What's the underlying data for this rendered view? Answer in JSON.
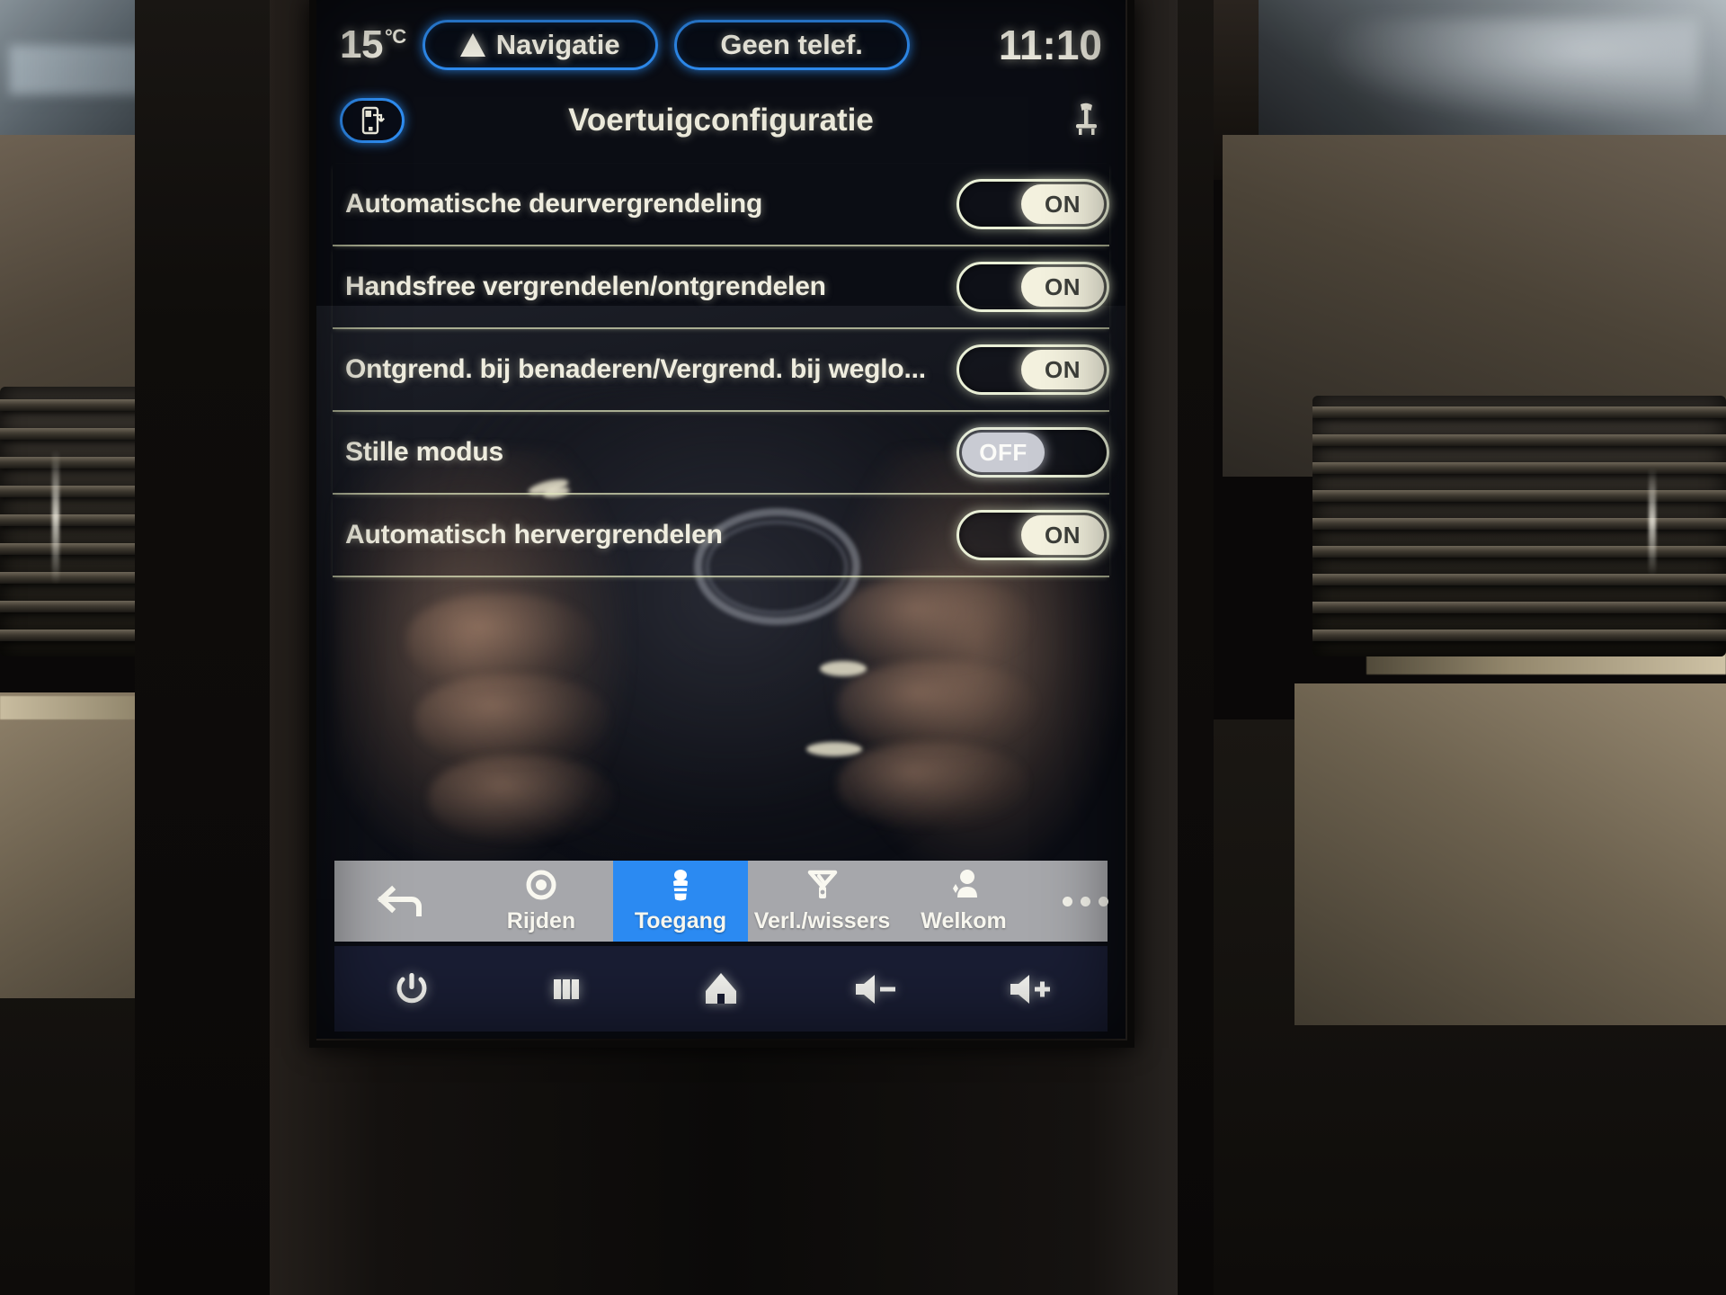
{
  "statusbar": {
    "temperature": "15",
    "temperature_unit": "°C",
    "nav_pill": {
      "label": "Navigatie",
      "icon": "navigation-arrow-icon"
    },
    "phone_pill": {
      "label": "Geen telef."
    },
    "clock": "11:10",
    "accent_color": "#2e8cf0"
  },
  "header": {
    "left_button_icon": "phone-link-icon",
    "title": "Voertuigconfiguratie",
    "right_icon": "seat-memory-icon"
  },
  "settings": {
    "rows": [
      {
        "label": "Automatische deurvergrendeling",
        "state": "ON",
        "on": true
      },
      {
        "label": "Handsfree vergrendelen/ontgrendelen",
        "state": "ON",
        "on": true
      },
      {
        "label": "Ontgrend. bij benaderen/Vergrend. bij weglo...",
        "state": "ON",
        "on": true
      },
      {
        "label": "Stille modus",
        "state": "OFF",
        "on": false
      },
      {
        "label": "Automatisch hervergrendelen",
        "state": "ON",
        "on": true
      }
    ]
  },
  "tabbar": {
    "active_color": "#2b8af2",
    "background_color": "#a6a7ab",
    "items": [
      {
        "name": "back",
        "label": "",
        "icon": "back-arrow-icon",
        "active": false
      },
      {
        "name": "drive",
        "label": "Rijden",
        "icon": "steering-wheel-icon",
        "active": false
      },
      {
        "name": "access",
        "label": "Toegang",
        "icon": "key-access-icon",
        "active": true
      },
      {
        "name": "lights",
        "label": "Verl./wissers",
        "icon": "wiper-light-icon",
        "active": false
      },
      {
        "name": "welcome",
        "label": "Welkom",
        "icon": "welcome-user-icon",
        "active": false
      },
      {
        "name": "more",
        "label": "",
        "icon": "ellipsis-icon",
        "active": false
      }
    ]
  },
  "sysbar": {
    "buttons": [
      {
        "name": "power",
        "icon": "power-icon"
      },
      {
        "name": "apps",
        "icon": "apps-grid-icon"
      },
      {
        "name": "home",
        "icon": "home-icon"
      },
      {
        "name": "volume-down",
        "icon": "volume-down-icon"
      },
      {
        "name": "volume-up",
        "icon": "volume-up-icon"
      }
    ]
  }
}
